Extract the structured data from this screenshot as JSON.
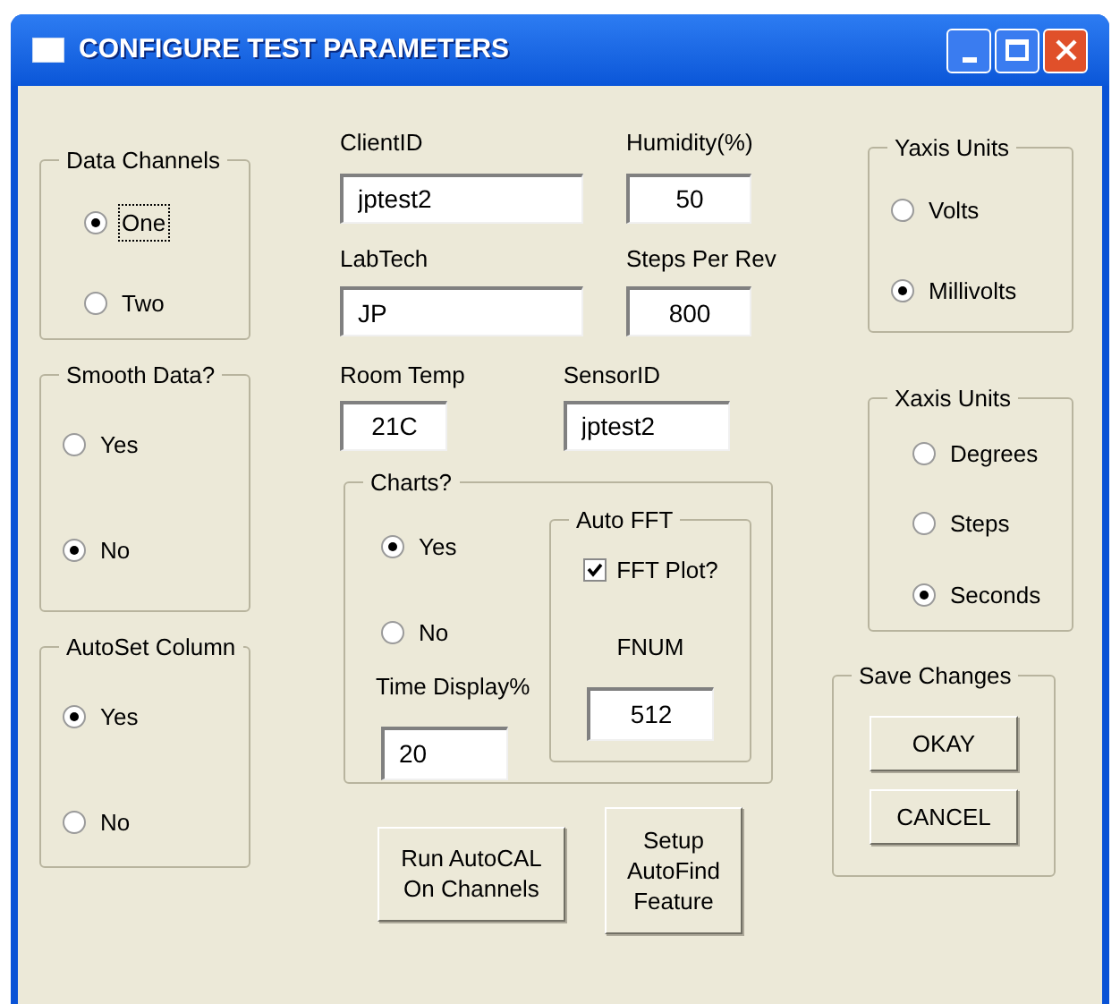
{
  "window": {
    "title": "CONFIGURE TEST PARAMETERS"
  },
  "data_channels": {
    "title": "Data Channels",
    "options": [
      {
        "label": "One",
        "selected": true,
        "focused": true
      },
      {
        "label": "Two",
        "selected": false,
        "focused": false
      }
    ]
  },
  "smooth_data": {
    "title": "Smooth Data?",
    "options": [
      {
        "label": "Yes",
        "selected": false,
        "focused": false
      },
      {
        "label": "No",
        "selected": true,
        "focused": false
      }
    ]
  },
  "autoset_column": {
    "title": "AutoSet Column",
    "options": [
      {
        "label": "Yes",
        "selected": true,
        "focused": false
      },
      {
        "label": "No",
        "selected": false,
        "focused": false
      }
    ]
  },
  "client_id": {
    "label": "ClientID",
    "value": "jptest2"
  },
  "humidity": {
    "label": "Humidity(%)",
    "value": "50"
  },
  "lab_tech": {
    "label": "LabTech",
    "value": "JP"
  },
  "steps_per_rev": {
    "label": "Steps Per Rev",
    "value": "800"
  },
  "room_temp": {
    "label": "Room Temp",
    "value": "21C"
  },
  "sensor_id": {
    "label": "SensorID",
    "value": "jptest2"
  },
  "charts": {
    "title": "Charts?",
    "options": [
      {
        "label": "Yes",
        "selected": true,
        "focused": false
      },
      {
        "label": "No",
        "selected": false,
        "focused": false
      }
    ],
    "time_display": {
      "label": "Time Display%",
      "value": "20"
    },
    "auto_fft": {
      "title": "Auto FFT",
      "fft_plot": {
        "label": "FFT Plot?",
        "checked": true
      },
      "fnum": {
        "label": "FNUM",
        "value": "512"
      }
    }
  },
  "buttons": [
    "Run AutoCAL\nOn Channels",
    "Setup\nAutoFind\nFeature"
  ],
  "yaxis_units": {
    "title": "Yaxis Units",
    "options": [
      {
        "label": "Volts",
        "selected": false,
        "focused": false
      },
      {
        "label": "Millivolts",
        "selected": true,
        "focused": false
      }
    ]
  },
  "xaxis_units": {
    "title": "Xaxis Units",
    "options": [
      {
        "label": "Degrees",
        "selected": false,
        "focused": false
      },
      {
        "label": "Steps",
        "selected": false,
        "focused": false
      },
      {
        "label": "Seconds",
        "selected": true,
        "focused": false
      }
    ]
  },
  "save_changes": {
    "title": "Save Changes",
    "buttons": [
      "OKAY",
      "CANCEL"
    ]
  }
}
